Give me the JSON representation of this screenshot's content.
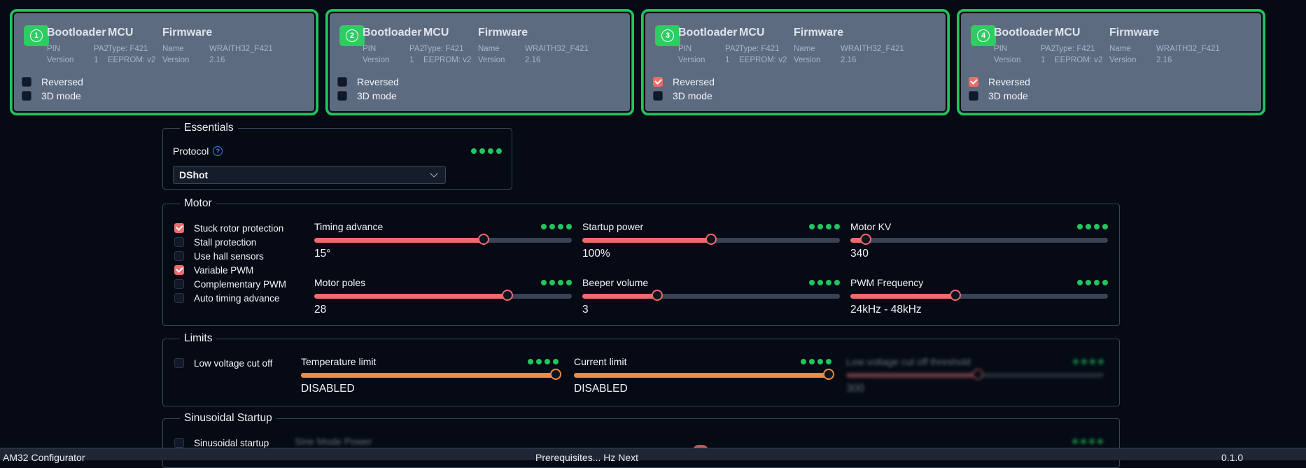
{
  "escs": [
    {
      "num": "1",
      "bootloader": {
        "title": "Bootloader",
        "pin_key": "PIN",
        "pin": "PA2",
        "ver_key": "Version",
        "ver": "1"
      },
      "mcu": {
        "title": "MCU",
        "type": "Type: F421",
        "eeprom": "EEPROM: v2"
      },
      "firmware": {
        "title": "Firmware",
        "name_key": "Name",
        "name": "WRAITH32_F421",
        "ver_key": "Version",
        "ver": "2.16"
      },
      "reversed_label": "Reversed",
      "reversed": false,
      "mode3d_label": "3D mode",
      "mode3d": false
    },
    {
      "num": "2",
      "bootloader": {
        "title": "Bootloader",
        "pin_key": "PIN",
        "pin": "PA2",
        "ver_key": "Version",
        "ver": "1"
      },
      "mcu": {
        "title": "MCU",
        "type": "Type: F421",
        "eeprom": "EEPROM: v2"
      },
      "firmware": {
        "title": "Firmware",
        "name_key": "Name",
        "name": "WRAITH32_F421",
        "ver_key": "Version",
        "ver": "2.16"
      },
      "reversed_label": "Reversed",
      "reversed": false,
      "mode3d_label": "3D mode",
      "mode3d": false
    },
    {
      "num": "3",
      "bootloader": {
        "title": "Bootloader",
        "pin_key": "PIN",
        "pin": "PA2",
        "ver_key": "Version",
        "ver": "1"
      },
      "mcu": {
        "title": "MCU",
        "type": "Type: F421",
        "eeprom": "EEPROM: v2"
      },
      "firmware": {
        "title": "Firmware",
        "name_key": "Name",
        "name": "WRAITH32_F421",
        "ver_key": "Version",
        "ver": "2.16"
      },
      "reversed_label": "Reversed",
      "reversed": true,
      "mode3d_label": "3D mode",
      "mode3d": false
    },
    {
      "num": "4",
      "bootloader": {
        "title": "Bootloader",
        "pin_key": "PIN",
        "pin": "PA2",
        "ver_key": "Version",
        "ver": "1"
      },
      "mcu": {
        "title": "MCU",
        "type": "Type: F421",
        "eeprom": "EEPROM: v2"
      },
      "firmware": {
        "title": "Firmware",
        "name_key": "Name",
        "name": "WRAITH32_F421",
        "ver_key": "Version",
        "ver": "2.16"
      },
      "reversed_label": "Reversed",
      "reversed": true,
      "mode3d_label": "3D mode",
      "mode3d": false
    }
  ],
  "essentials": {
    "legend": "Essentials",
    "protocol_label": "Protocol",
    "help_icon": "?",
    "protocol_value": "DShot"
  },
  "motor": {
    "legend": "Motor",
    "checks": [
      {
        "label": "Stuck rotor protection",
        "checked": true
      },
      {
        "label": "Stall protection",
        "checked": false
      },
      {
        "label": "Use hall sensors",
        "checked": false
      },
      {
        "label": "Variable PWM",
        "checked": true
      },
      {
        "label": "Complementary PWM",
        "checked": false
      },
      {
        "label": "Auto timing advance",
        "checked": false
      }
    ],
    "sliders": [
      {
        "label": "Timing advance",
        "value": "15°",
        "fraction": 0.66
      },
      {
        "label": "Startup power",
        "value": "100%",
        "fraction": 0.5
      },
      {
        "label": "Motor KV",
        "value": "340",
        "fraction": 0.05
      },
      {
        "label": "Motor poles",
        "value": "28",
        "fraction": 0.755
      },
      {
        "label": "Beeper volume",
        "value": "3",
        "fraction": 0.285
      },
      {
        "label": "PWM Frequency",
        "value": "24kHz - 48kHz",
        "fraction": 0.405
      }
    ]
  },
  "limits": {
    "legend": "Limits",
    "check": {
      "label": "Low voltage cut off",
      "checked": false
    },
    "sliders": [
      {
        "label": "Temperature limit",
        "value": "DISABLED",
        "fraction": 1.0
      },
      {
        "label": "Current limit",
        "value": "DISABLED",
        "fraction": 1.0
      },
      {
        "label": "Low voltage cut off threshold",
        "value": "300",
        "fraction": 0.51
      }
    ]
  },
  "sinusoidal": {
    "legend": "Sinusoidal Startup",
    "check": {
      "label": "Sinusoidal startup",
      "checked": false
    },
    "slider_label": "Sine Mode Power"
  },
  "footer": {
    "app": "AM32 Configurator",
    "mid": "Prerequisites... Hz Next",
    "version": "0.1.0"
  },
  "colors": {
    "accent_green": "#22c55e",
    "slider_red": "#ef6b6b",
    "slider_orange": "#f68a36",
    "panel": "#5d6b80"
  }
}
